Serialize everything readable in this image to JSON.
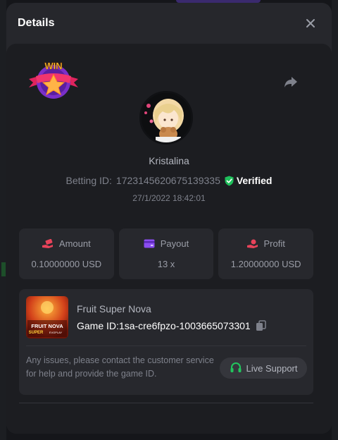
{
  "modal": {
    "title": "Details"
  },
  "player": {
    "username": "Kristalina",
    "betting_id_label": "Betting ID:",
    "betting_id": "1723145620675139335",
    "verified_label": "Verified",
    "timestamp": "27/1/2022 18:42:01"
  },
  "badge": {
    "text": "WIN"
  },
  "stats": [
    {
      "label": "Amount",
      "value": "0.10000000 USD",
      "icon": "money-hand-icon",
      "color": "#e8435a"
    },
    {
      "label": "Payout",
      "value": "13 x",
      "icon": "card-icon",
      "color": "#8a4cf0"
    },
    {
      "label": "Profit",
      "value": "1.20000000 USD",
      "icon": "profit-hand-icon",
      "color": "#e8435a"
    }
  ],
  "game": {
    "name": "Fruit Super Nova",
    "game_id_label": "Game ID:",
    "game_id": "1sa-cre6fpzo-1003665073301",
    "thumb_title_1": "FRUIT NOVA",
    "thumb_title_2": "SUPER",
    "thumb_brand": "EVOPLAY"
  },
  "help": {
    "text": "Any issues, please contact the customer service for help and provide the game ID.",
    "support_label": "Live Support"
  },
  "colors": {
    "verified_green": "#1fbf5b",
    "support_green": "#22c55e"
  }
}
